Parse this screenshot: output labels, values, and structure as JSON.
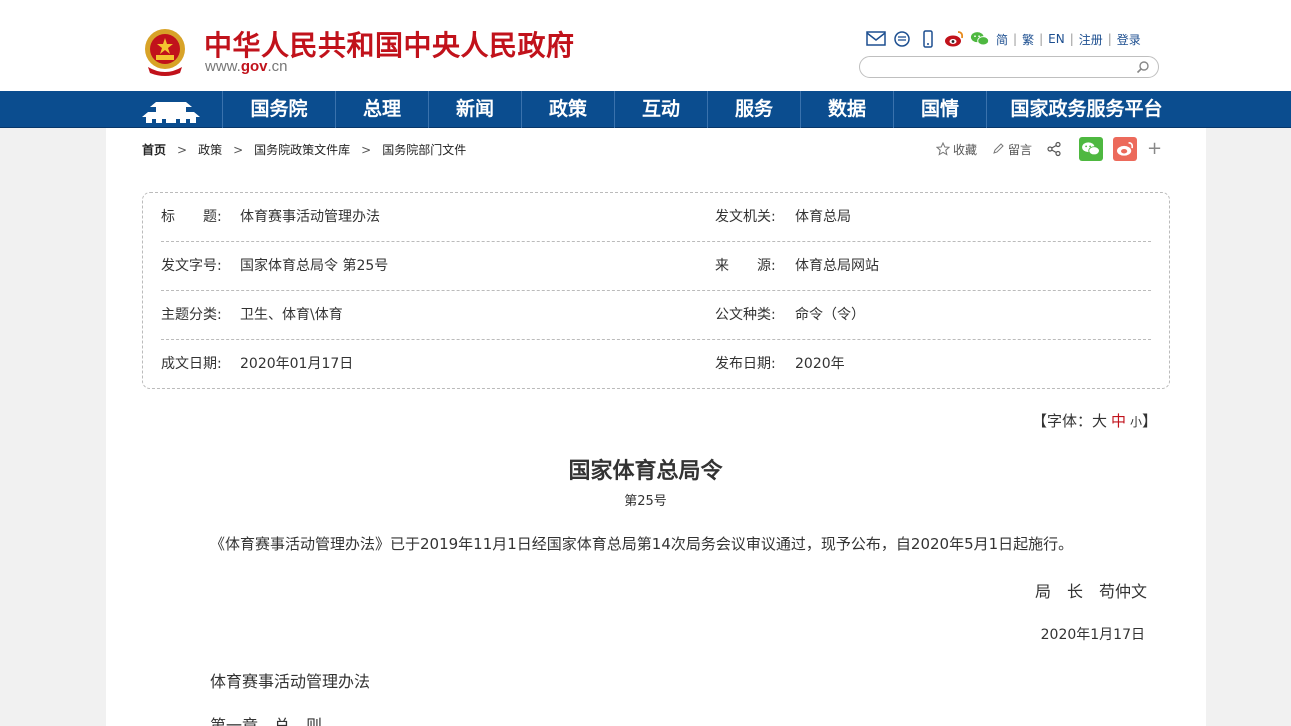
{
  "header": {
    "site_title": "中华人民共和国中央人民政府",
    "domain_prefix": "www.",
    "domain_gov": "gov",
    "domain_suffix": ".cn",
    "lang_links": [
      "简",
      "繁",
      "EN",
      "注册",
      "登录"
    ],
    "icons": [
      "mail-icon",
      "message-icon",
      "mobile-icon",
      "weibo-icon",
      "wechat-icon"
    ],
    "search_placeholder": ""
  },
  "nav": {
    "items": [
      {
        "label": "国务院"
      },
      {
        "label": "总理"
      },
      {
        "label": "新闻"
      },
      {
        "label": "政策"
      },
      {
        "label": "互动"
      },
      {
        "label": "服务"
      },
      {
        "label": "数据"
      },
      {
        "label": "国情"
      },
      {
        "label": "国家政务服务平台"
      }
    ]
  },
  "breadcrumb": [
    "首页",
    "政策",
    "国务院政策文件库",
    "国务院部门文件"
  ],
  "tools": {
    "favorite": "收藏",
    "comment": "留言"
  },
  "info": {
    "rows": [
      {
        "l1": "标　　题:",
        "v1": "体育赛事活动管理办法",
        "l2": "发文机关:",
        "v2": "体育总局"
      },
      {
        "l1": "发文字号:",
        "v1": "国家体育总局令 第25号",
        "l2": "来　　源:",
        "v2": "体育总局网站"
      },
      {
        "l1": "主题分类:",
        "v1": "卫生、体育\\体育",
        "l2": "公文种类:",
        "v2": "命令（令）"
      },
      {
        "l1": "成文日期:",
        "v1": "2020年01月17日",
        "l2": "发布日期:",
        "v2": "2020年"
      }
    ]
  },
  "font_size": {
    "prefix": "【字体：",
    "large": "大",
    "medium": "中",
    "small": "小",
    "suffix": "】"
  },
  "document": {
    "title": "国家体育总局令",
    "number": "第25号",
    "paragraph": "《体育赛事活动管理办法》已于2019年11月1日经国家体育总局第14次局务会议审议通过，现予公布，自2020年5月1日起施行。",
    "signature": "局　长　苟仲文",
    "date": "2020年1月17日",
    "subtitle": "体育赛事活动管理办法",
    "chapter": "第一章　总　则"
  },
  "colors": {
    "brand_red": "#c1121b",
    "nav_blue": "#0b4d8f",
    "link_blue": "#1d4f90"
  }
}
